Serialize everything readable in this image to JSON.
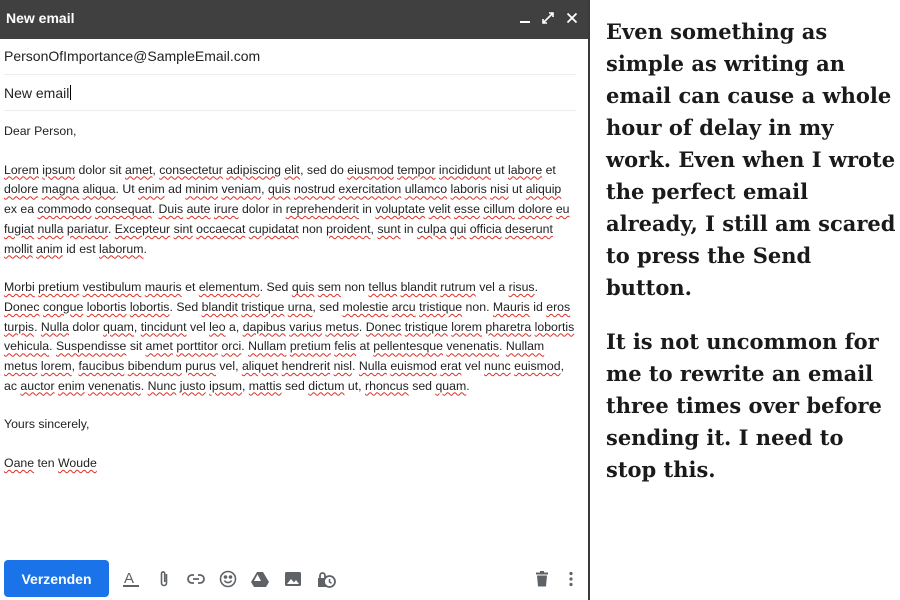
{
  "window": {
    "title": "New email",
    "icons": [
      "minimize-icon",
      "expand-icon",
      "close-icon"
    ]
  },
  "fields": {
    "to": "PersonOfImportance@SampleEmail.com",
    "subject": "New email"
  },
  "body": {
    "greeting": "Dear Person,",
    "paragraph1": "Lorem ipsum dolor sit amet, consectetur adipiscing elit, sed do eiusmod tempor incididunt ut labore et dolore magna aliqua. Ut enim ad minim veniam, quis nostrud exercitation ullamco laboris nisi ut aliquip ex ea commodo consequat. Duis aute irure dolor in reprehenderit in voluptate velit esse cillum dolore eu fugiat nulla pariatur. Excepteur sint occaecat cupidatat non proident, sunt in culpa qui officia deserunt mollit anim id est laborum.",
    "paragraph2": "Morbi pretium vestibulum mauris et elementum. Sed quis sem non tellus blandit rutrum vel a risus. Donec congue lobortis lobortis. Sed blandit tristique urna, sed molestie arcu tristique non. Mauris id eros turpis. Nulla dolor quam, tincidunt vel leo a, dapibus varius metus. Donec tristique lorem pharetra lobortis vehicula. Suspendisse sit amet porttitor orci. Nullam pretium felis at pellentesque venenatis. Nullam metus lorem, faucibus bibendum purus vel, aliquet hendrerit nisl. Nulla euismod erat vel nunc euismod, ac auctor enim venenatis. Nunc justo ipsum, mattis sed dictum ut, rhoncus sed quam.",
    "closing": "Yours sincerely,",
    "signature": "Oane ten Woude",
    "spellcheck_color": "#d93025"
  },
  "toolbar": {
    "send_label": "Verzenden",
    "send_color": "#1a73e8",
    "icons": [
      "format-text-icon",
      "attach-icon",
      "link-icon",
      "emoji-icon",
      "drive-icon",
      "image-icon",
      "schedule-icon",
      "delete-icon",
      "more-options-icon"
    ]
  },
  "sidenote": {
    "paragraph1": "Even something as simple as writing an email can cause a whole hour of delay in my work. Even when I wrote the perfect email already, I still am scared to press the Send button.",
    "paragraph2": "It is not uncommon for me to rewrite an email three times over before sending it. I need to stop this."
  }
}
